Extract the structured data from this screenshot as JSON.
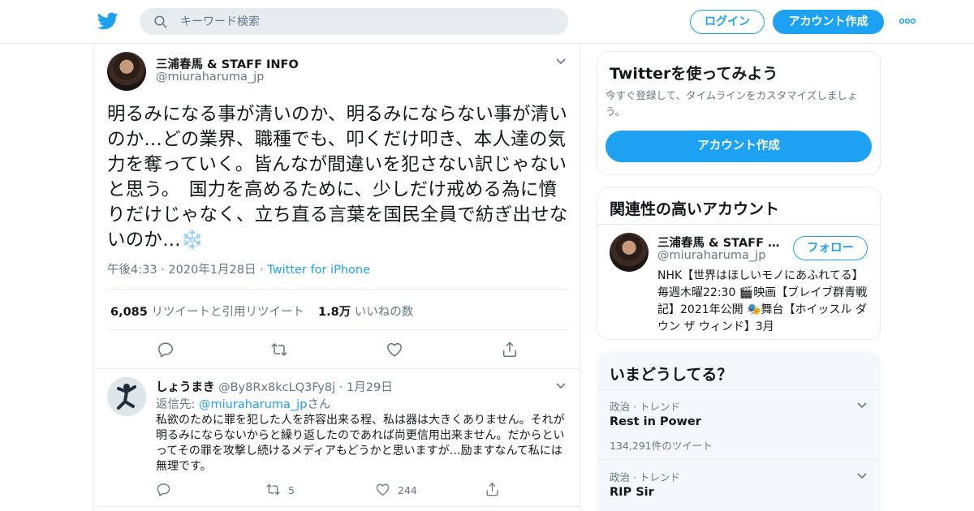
{
  "header": {
    "search_placeholder": "キーワード検索",
    "login_label": "ログイン",
    "signup_label": "アカウント作成",
    "brand_color": "#1da1f2"
  },
  "tweet": {
    "name": "三浦春馬 & STAFF INFO",
    "handle": "@miuraharuma_jp",
    "text": "明るみになる事が清いのか、明るみにならない事が清いのか…どの業界、職種でも、叩くだけ叩き、本人達の気力を奪っていく。皆んなが間違いを犯さない訳じゃないと思う。　国力を高めるために、少しだけ戒める為に憤りだけじゃなく、立ち直る言葉を国民全員で紡ぎ出せないのか…❄️",
    "time": "午後4:33",
    "date": "2020年1月28日",
    "source": "Twitter for iPhone",
    "retweets": "6,085",
    "retweets_label": "リツイートと引用リツイート",
    "likes": "1.8万",
    "likes_label": "いいねの数"
  },
  "reply": {
    "name": "しょうまき",
    "handle": "@By8Rx8kcLQ3Fy8j",
    "date": "1月29日",
    "to_prefix": "返信先: ",
    "to_handle": "@miuraharuma_jp",
    "to_suffix": "さん",
    "text": "私欲のために罪を犯した人を許容出来る程、私は器は大きくありません。それが明るみにならないからと繰り返したのであれば尚更信用出来ません。だからといってその罪を攻撃し続けるメディアもどうかと思いますが…励ますなんて私には無理です。",
    "retweets": "5",
    "likes": "244"
  },
  "signup_card": {
    "title": "Twitterを使ってみよう",
    "description": "今すぐ登録して、タイムラインをカスタマイズしましょう。",
    "button": "アカウント作成"
  },
  "related_card": {
    "title": "関連性の高いアカウント",
    "name": "三浦春馬 & STAFF INFO",
    "handle": "@miuraharuma_jp",
    "follow_label": "フォロー",
    "bio": "NHK【世界はほしいモノにあふれてる】毎週木曜22:30 🎬映画【ブレイブ群青戦記】2021年公開 🎭舞台【ホイッスル ダウン ザ ウィンド】3月"
  },
  "trends_card": {
    "title": "いまどうしてる？",
    "items": [
      {
        "category": "政治 · トレンド",
        "name": "Rest in Power",
        "count": "134,291件のツイート"
      },
      {
        "category": "政治 · トレンド",
        "name": "RIP Sir",
        "count": ""
      }
    ]
  }
}
